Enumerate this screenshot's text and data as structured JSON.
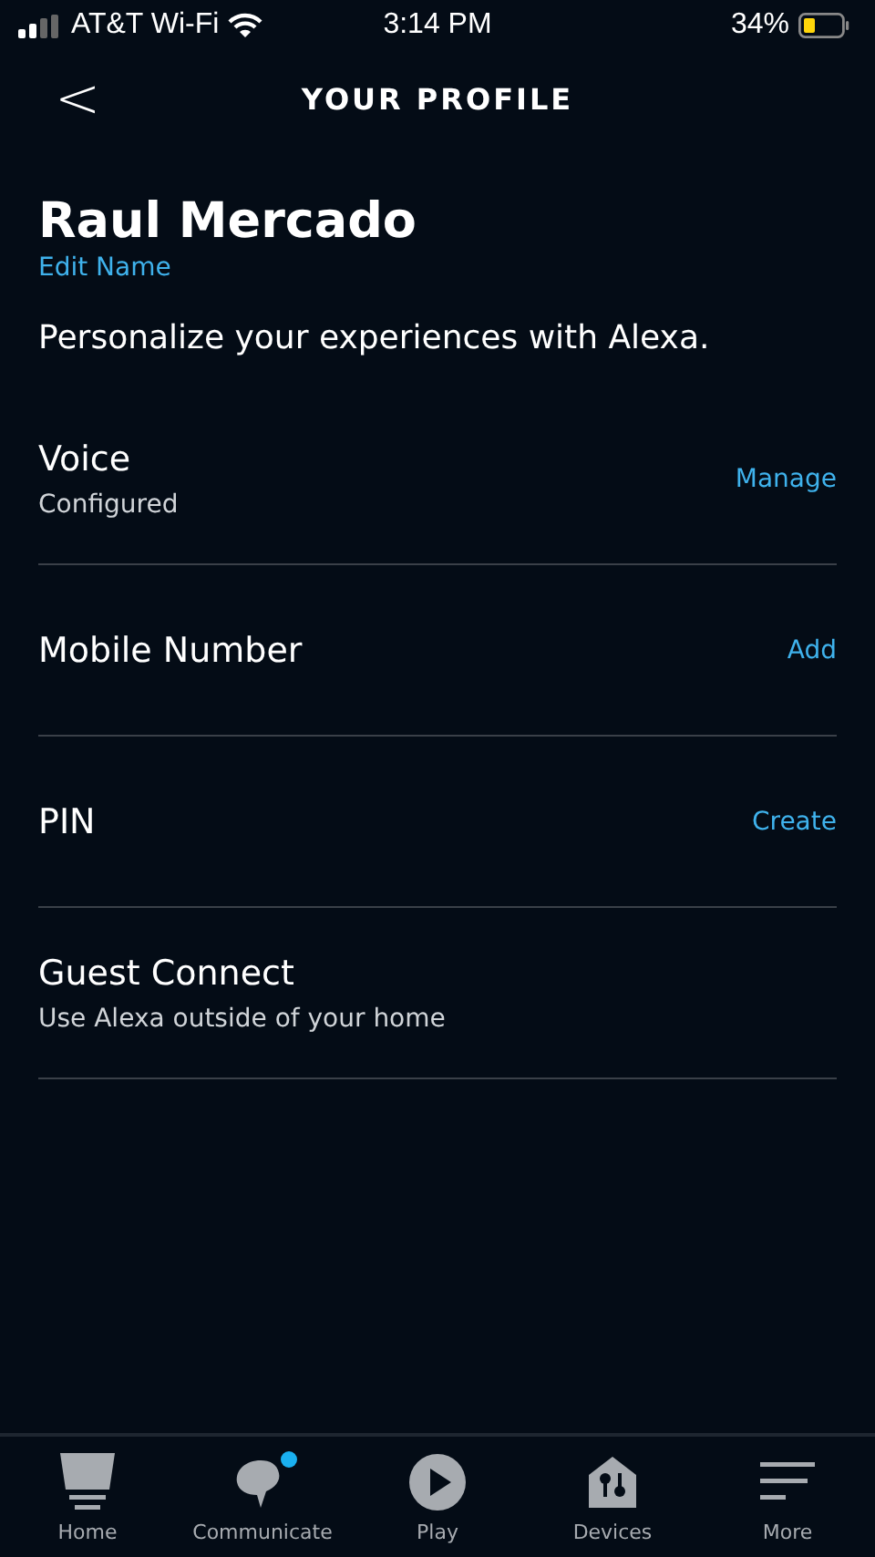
{
  "status_bar": {
    "carrier": "AT&T Wi-Fi",
    "time": "3:14 PM",
    "battery": "34%"
  },
  "header": {
    "back": "<",
    "title": "YOUR PROFILE"
  },
  "profile": {
    "name": "Raul Mercado",
    "edit_link": "Edit Name",
    "description": "Personalize your experiences with Alexa."
  },
  "settings": [
    {
      "title": "Voice",
      "subtitle": "Configured",
      "action": "Manage"
    },
    {
      "title": "Mobile Number",
      "action": "Add"
    },
    {
      "title": "PIN",
      "action": "Create"
    },
    {
      "title": "Guest Connect",
      "subtitle": "Use Alexa outside of your home"
    }
  ],
  "tabs": [
    {
      "label": "Home",
      "selected": false,
      "badge": false
    },
    {
      "label": "Communicate",
      "selected": false,
      "badge": true
    },
    {
      "label": "Play",
      "selected": false,
      "badge": false
    },
    {
      "label": "Devices",
      "selected": false,
      "badge": false
    },
    {
      "label": "More",
      "selected": false,
      "badge": false
    }
  ]
}
